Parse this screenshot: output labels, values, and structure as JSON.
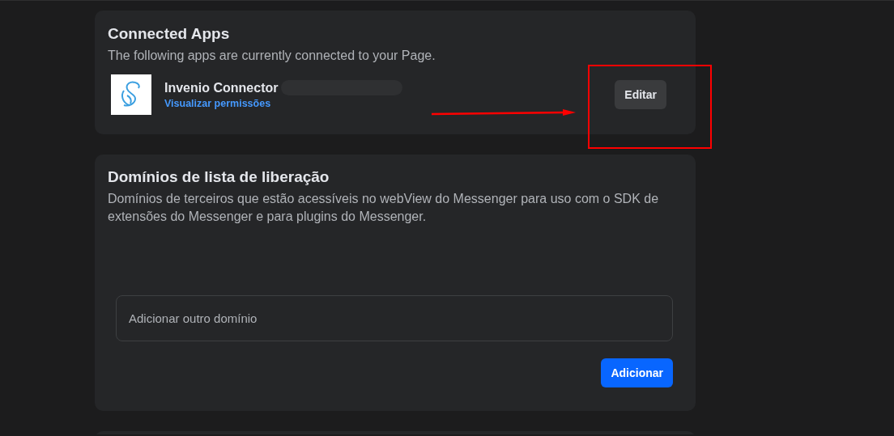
{
  "connected_apps": {
    "title": "Connected Apps",
    "description": "The following apps are currently connected to your Page.",
    "apps": [
      {
        "name": "Invenio Connector",
        "link": "Visualizar permissões",
        "button": "Editar"
      }
    ]
  },
  "whitelist_domains": {
    "title": "Domínios de lista de liberação",
    "description": "Domínios de terceiros que estão acessíveis no webView do Messenger para uso com o SDK de extensões do Messenger e para plugins do Messenger.",
    "input": {
      "placeholder": "Adicionar outro domínio"
    },
    "button": "Adicionar"
  }
}
